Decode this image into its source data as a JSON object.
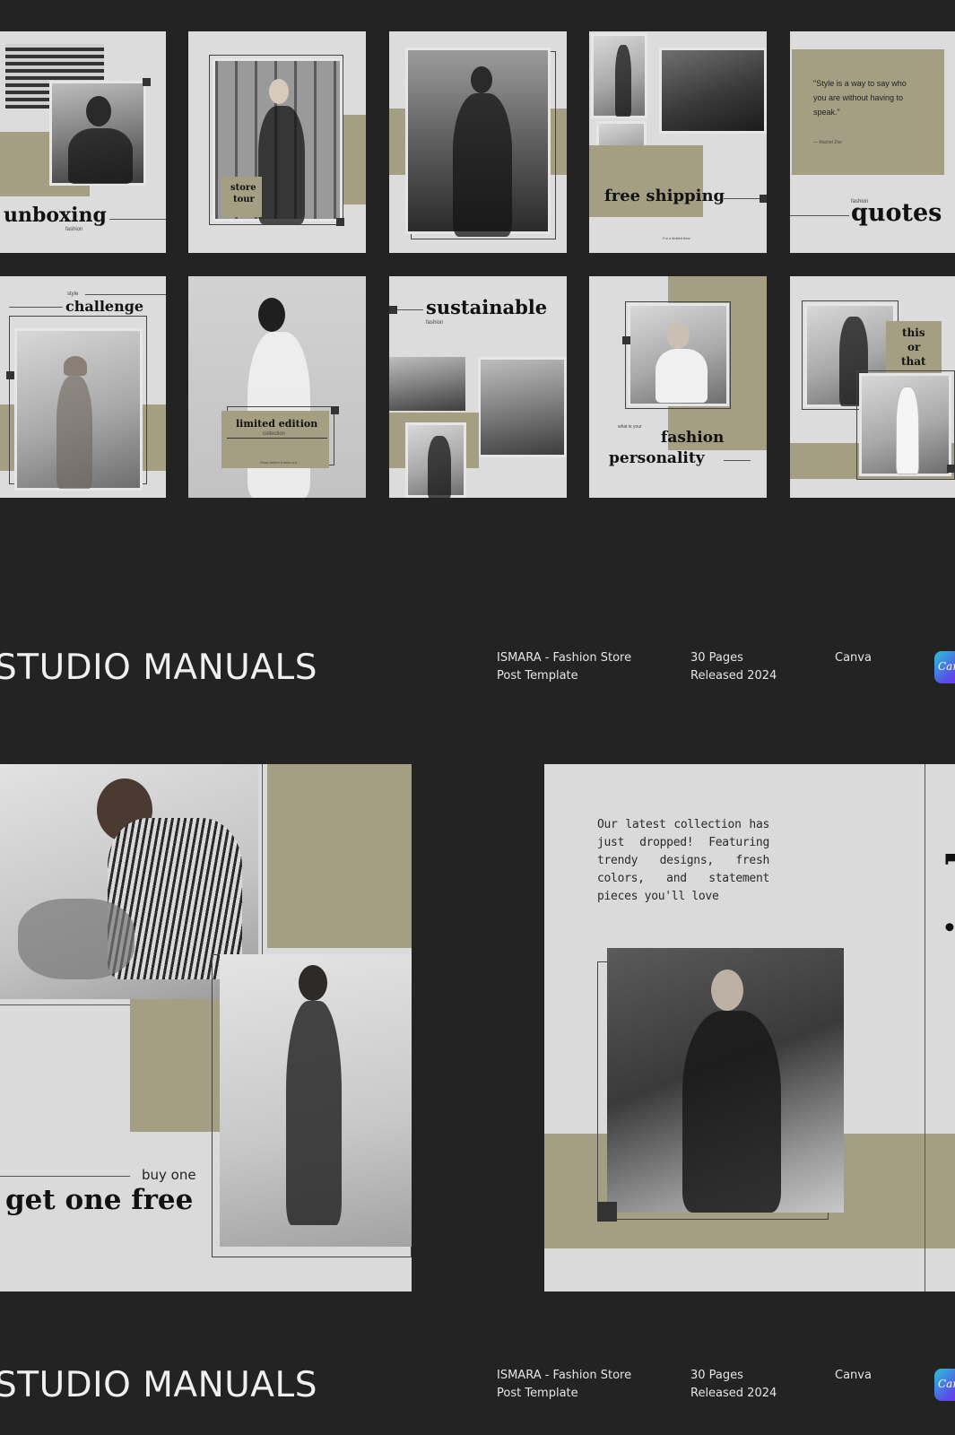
{
  "grid": {
    "row1": {
      "unboxing": {
        "title": "unboxing",
        "subtitle": "fashion"
      },
      "store_tour": {
        "line1": "store",
        "line2": "tour"
      },
      "free_shipping": {
        "title": "free shipping",
        "note": "For a limited time"
      },
      "quotes": {
        "quote": "\"Style is a way to say who you are without having to speak.\"",
        "author": "— Rachel Zoe",
        "kicker": "fashion",
        "title": "quotes"
      }
    },
    "row2": {
      "challenge": {
        "kicker": "style",
        "title": "challenge"
      },
      "limited": {
        "title": "limited edition",
        "sub": "collection",
        "note": "Shop before it sells out"
      },
      "sustainable": {
        "title": "sustainable",
        "sub": "fashion"
      },
      "personality": {
        "kicker": "what is your",
        "line1": "fashion",
        "line2": "personality"
      },
      "this_or_that": {
        "line1": "this",
        "line2": "or",
        "line3": "that"
      }
    }
  },
  "footer_top": {
    "brand": "STUDIO MANUALS",
    "product_line1": "ISMARA - Fashion Store",
    "product_line2": "Post Template",
    "pages": "30 Pages",
    "released": "Released 2024",
    "platform": "Canva",
    "badge": "Canva"
  },
  "promo_left": {
    "kicker": "buy one",
    "title": "get one free"
  },
  "promo_right": {
    "body": "Our latest collection has just dropped! Featuring trendy designs, fresh colors, and statement pieces you'll love",
    "vertical_title": "new arrivals"
  },
  "footer_bottom": {
    "brand": "STUDIO MANUALS",
    "product_line1": "ISMARA - Fashion Store",
    "product_line2": "Post Template",
    "pages": "30 Pages",
    "released": "Released 2024",
    "platform": "Canva",
    "badge": "Canva"
  },
  "colors": {
    "background": "#232323",
    "card": "#dcdcdc",
    "accent": "#a49f83"
  }
}
